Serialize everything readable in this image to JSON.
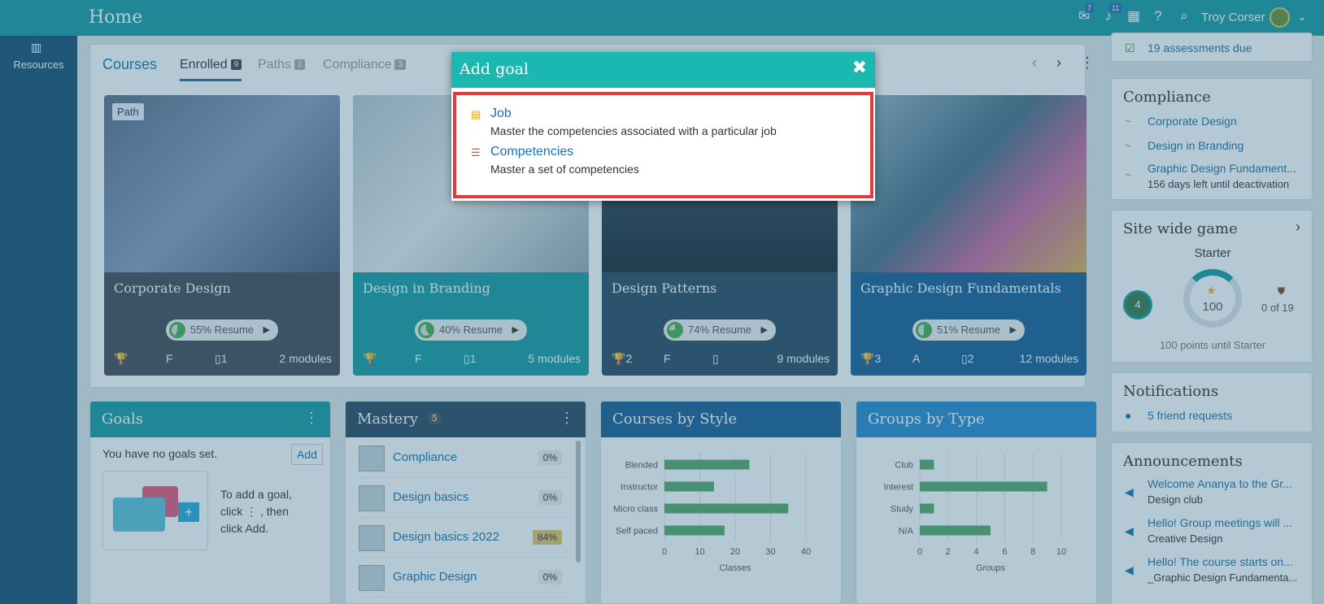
{
  "header": {
    "title": "Home",
    "user_name": "Troy Corser",
    "inbox_badge": "7",
    "notifications_badge": "11"
  },
  "sidebar": {
    "resources_label": "Resources"
  },
  "courses": {
    "tabs": [
      {
        "label": "Courses"
      },
      {
        "label": "Enrolled",
        "count": "9"
      },
      {
        "label": "Paths",
        "count": "2"
      },
      {
        "label": "Compliance",
        "count": "3"
      }
    ],
    "cards": [
      {
        "title": "Corporate Design",
        "chip": "Path",
        "resume": "55% Resume",
        "progress": 0.55,
        "trophy": "",
        "grade": "F",
        "doc": "1",
        "modules": "2 modules"
      },
      {
        "title": "Design in Branding",
        "resume": "40% Resume",
        "progress": 0.4,
        "trophy": "",
        "grade": "F",
        "doc": "1",
        "modules": "5 modules"
      },
      {
        "title": "Design Patterns",
        "resume": "74% Resume",
        "progress": 0.74,
        "trophy": "2",
        "grade": "F",
        "doc": "",
        "modules": "9 modules"
      },
      {
        "title": "Graphic Design Fundamentals",
        "resume": "51% Resume",
        "progress": 0.51,
        "trophy": "3",
        "grade": "A",
        "doc": "2",
        "modules": "12 modules"
      }
    ]
  },
  "goals": {
    "title": "Goals",
    "empty": "You have no goals set.",
    "add": "Add",
    "help_1": "To add a goal, click",
    "help_2": ", then click Add."
  },
  "mastery": {
    "title": "Mastery",
    "count": "5",
    "rows": [
      {
        "label": "Compliance",
        "pct": "0%"
      },
      {
        "label": "Design basics",
        "pct": "0%"
      },
      {
        "label": "Design basics 2022",
        "pct": "84%"
      },
      {
        "label": "Graphic Design",
        "pct": "0%"
      }
    ]
  },
  "courses_by_style": {
    "title": "Courses by Style"
  },
  "groups_by_type": {
    "title": "Groups by Type"
  },
  "chart_data": [
    {
      "type": "bar",
      "title": "Courses by Style",
      "categories": [
        "Blended",
        "Instructor",
        "Micro class",
        "Self paced"
      ],
      "values": [
        24,
        14,
        35,
        17
      ],
      "xlabel": "Classes",
      "ylabel": "",
      "xlim": [
        0,
        40
      ],
      "ticks": [
        0,
        10,
        20,
        30,
        40
      ],
      "grid": true,
      "color": "#5aa86a"
    },
    {
      "type": "bar",
      "title": "Groups by Type",
      "categories": [
        "Club",
        "Interest",
        "Study",
        "N/A"
      ],
      "values": [
        1,
        9,
        1,
        5
      ],
      "xlabel": "Groups",
      "ylabel": "",
      "xlim": [
        0,
        10
      ],
      "ticks": [
        0,
        2,
        4,
        6,
        8,
        10
      ],
      "grid": true,
      "color": "#5aa86a"
    }
  ],
  "right": {
    "assessments": "19 assessments due",
    "compliance_title": "Compliance",
    "compliance_items": [
      "Corporate Design",
      "Design in Branding",
      "Graphic Design Fundament..."
    ],
    "compliance_note": "156 days left until deactivation",
    "game_title": "Site wide game",
    "game_level": "Starter",
    "game_points": "100",
    "game_badge_count": "4",
    "game_badges": "0 of 19",
    "game_until": "100 points until Starter",
    "notifications_title": "Notifications",
    "friend_requests": "5 friend requests",
    "announcements_title": "Announcements",
    "announcements": [
      {
        "title": "Welcome Ananya to the Gr...",
        "sub": "Design club"
      },
      {
        "title": "Hello! Group meetings will ...",
        "sub": "Creative Design"
      },
      {
        "title": "Hello! The course starts on...",
        "sub": "_Graphic Design Fundamenta..."
      }
    ]
  },
  "dialog": {
    "title": "Add goal",
    "options": [
      {
        "title": "Job",
        "desc": "Master the competencies associated with a particular job"
      },
      {
        "title": "Competencies",
        "desc": "Master a set of competencies"
      }
    ]
  }
}
